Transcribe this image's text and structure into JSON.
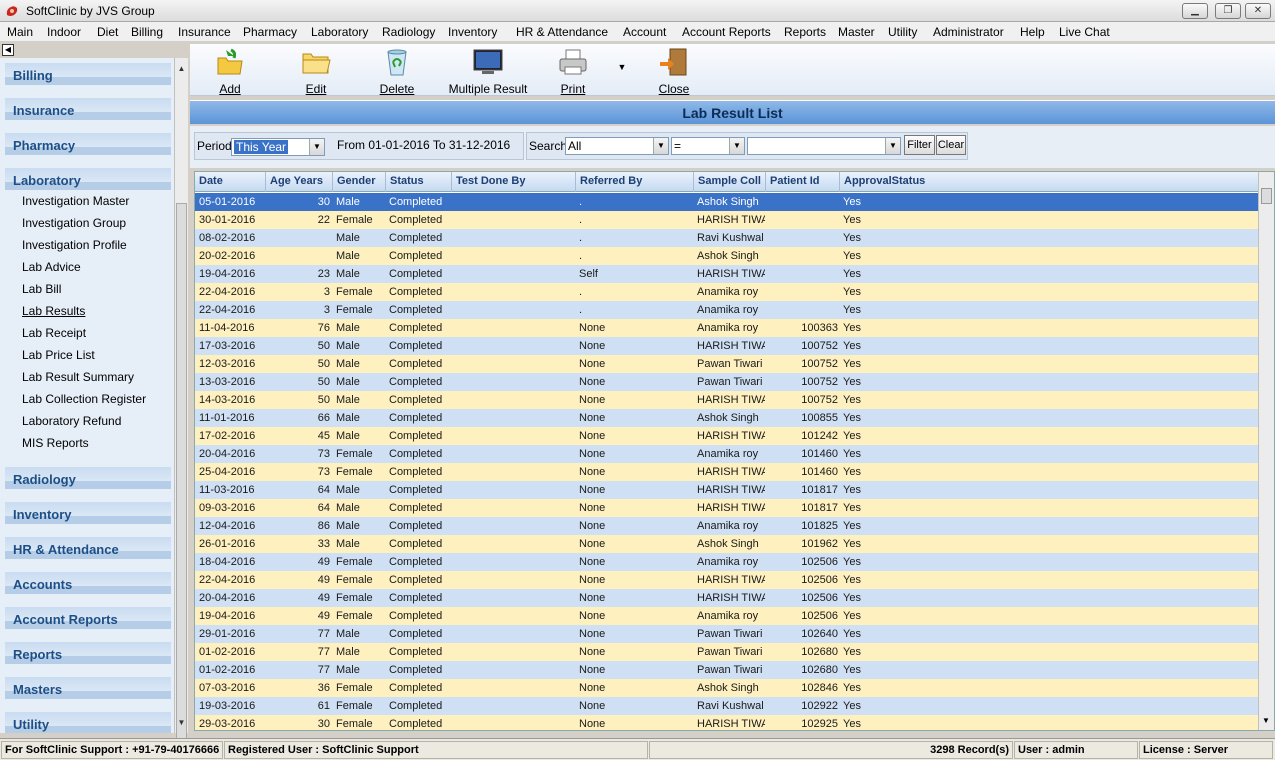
{
  "window": {
    "title": "SoftClinic by JVS Group"
  },
  "menu": [
    "Main",
    "Indoor",
    "Diet",
    "Billing",
    "Insurance",
    "Pharmacy",
    "Laboratory",
    "Radiology",
    "Inventory",
    "HR & Attendance",
    "Account",
    "Account Reports",
    "Reports",
    "Master",
    "Utility",
    "Administrator",
    "Help",
    "Live Chat"
  ],
  "sidebar": {
    "categories_top": [
      "Billing",
      "Insurance",
      "Pharmacy",
      "Laboratory"
    ],
    "laboratory_items": [
      "Investigation Master",
      "Investigation Group",
      "Investigation Profile",
      "Lab Advice",
      "Lab Bill",
      "Lab Results",
      "Lab Receipt",
      "Lab Price List",
      "Lab Result Summary",
      "Lab Collection Register",
      "Laboratory Refund",
      "MIS Reports"
    ],
    "active_item": "Lab Results",
    "categories_bottom": [
      "Radiology",
      "Inventory",
      "HR & Attendance",
      "Accounts",
      "Account Reports",
      "Reports",
      "Masters",
      "Utility"
    ]
  },
  "toolbar": {
    "add": "Add",
    "edit": "Edit",
    "delete": "Delete",
    "multiple_result": "Multiple Result",
    "print": "Print",
    "close": "Close"
  },
  "list_title": "Lab Result List",
  "filter": {
    "period_label": "Period",
    "period_value": "This Year",
    "date_range": "From  01-01-2016 To 31-12-2016",
    "search_label": "Search",
    "search_field": "All",
    "operator": "=",
    "search_value": "",
    "filter_btn": "Filter",
    "clear_btn": "Clear"
  },
  "grid": {
    "columns": [
      "Date",
      "Age Years",
      "Gender",
      "Status",
      "Test Done By",
      "Referred By",
      "Sample Coll",
      "Patient Id",
      "ApprovalStatus"
    ],
    "rows": [
      [
        "05-01-2016",
        "30",
        "Male",
        "Completed",
        "",
        ".",
        "Ashok Singh",
        "",
        "Yes"
      ],
      [
        "30-01-2016",
        "22",
        "Female",
        "Completed",
        "",
        ".",
        "HARISH TIWA",
        "",
        "Yes"
      ],
      [
        "08-02-2016",
        "",
        "Male",
        "Completed",
        "",
        ".",
        "Ravi Kushwal",
        "",
        "Yes"
      ],
      [
        "20-02-2016",
        "",
        "Male",
        "Completed",
        "",
        ".",
        "Ashok Singh",
        "",
        "Yes"
      ],
      [
        "19-04-2016",
        "23",
        "Male",
        "Completed",
        "",
        "Self",
        "HARISH TIWA",
        "",
        "Yes"
      ],
      [
        "22-04-2016",
        "3",
        "Female",
        "Completed",
        "",
        ".",
        "Anamika roy",
        "",
        "Yes"
      ],
      [
        "22-04-2016",
        "3",
        "Female",
        "Completed",
        "",
        ".",
        "Anamika roy",
        "",
        "Yes"
      ],
      [
        "11-04-2016",
        "76",
        "Male",
        "Completed",
        "",
        "None",
        "Anamika roy",
        "100363",
        "Yes"
      ],
      [
        "17-03-2016",
        "50",
        "Male",
        "Completed",
        "",
        " None",
        "HARISH TIWA",
        "100752",
        "Yes"
      ],
      [
        "12-03-2016",
        "50",
        "Male",
        "Completed",
        "",
        " None",
        "Pawan Tiwari",
        "100752",
        "Yes"
      ],
      [
        "13-03-2016",
        "50",
        "Male",
        "Completed",
        "",
        " None",
        "Pawan Tiwari",
        "100752",
        "Yes"
      ],
      [
        "14-03-2016",
        "50",
        "Male",
        "Completed",
        "",
        " None",
        "HARISH TIWA",
        "100752",
        "Yes"
      ],
      [
        "11-01-2016",
        "66",
        "Male",
        "Completed",
        "",
        "None",
        "Ashok Singh",
        "100855",
        "Yes"
      ],
      [
        "17-02-2016",
        "45",
        "Male",
        "Completed",
        "",
        " None",
        "HARISH TIWA",
        "101242",
        "Yes"
      ],
      [
        "20-04-2016",
        "73",
        "Female",
        "Completed",
        "",
        " None",
        "Anamika roy",
        "101460",
        "Yes"
      ],
      [
        "25-04-2016",
        "73",
        "Female",
        "Completed",
        "",
        " None",
        "HARISH TIWA",
        "101460",
        "Yes"
      ],
      [
        "11-03-2016",
        "64",
        "Male",
        "Completed",
        "",
        " None",
        "HARISH TIWA",
        "101817",
        "Yes"
      ],
      [
        "09-03-2016",
        "64",
        "Male",
        "Completed",
        "",
        " None",
        "HARISH TIWA",
        "101817",
        "Yes"
      ],
      [
        "12-04-2016",
        "86",
        "Male",
        "Completed",
        "",
        " None",
        "Anamika roy",
        "101825",
        "Yes"
      ],
      [
        "26-01-2016",
        "33",
        "Male",
        "Completed",
        "",
        " None",
        "Ashok Singh",
        "101962",
        "Yes"
      ],
      [
        "18-04-2016",
        "49",
        "Female",
        "Completed",
        "",
        " None",
        "Anamika roy",
        "102506",
        "Yes"
      ],
      [
        "22-04-2016",
        "49",
        "Female",
        "Completed",
        "",
        "None",
        "HARISH TIWA",
        "102506",
        "Yes"
      ],
      [
        "20-04-2016",
        "49",
        "Female",
        "Completed",
        "",
        " None",
        "HARISH TIWA",
        "102506",
        "Yes"
      ],
      [
        "19-04-2016",
        "49",
        "Female",
        "Completed",
        "",
        " None",
        "Anamika roy",
        "102506",
        "Yes"
      ],
      [
        "29-01-2016",
        "77",
        "Male",
        "Completed",
        "",
        " None",
        "Pawan Tiwari",
        "102640",
        "Yes"
      ],
      [
        "01-02-2016",
        "77",
        "Male",
        "Completed",
        "",
        " None",
        "Pawan Tiwari",
        "102680",
        "Yes"
      ],
      [
        "01-02-2016",
        "77",
        "Male",
        "Completed",
        "",
        " None",
        "Pawan Tiwari",
        "102680",
        "Yes"
      ],
      [
        "07-03-2016",
        "36",
        "Female",
        "Completed",
        "",
        " None",
        "Ashok Singh",
        "102846",
        "Yes"
      ],
      [
        "19-03-2016",
        "61",
        "Female",
        "Completed",
        "",
        " None",
        "Ravi Kushwal",
        "102922",
        "Yes"
      ],
      [
        "29-03-2016",
        "30",
        "Female",
        "Completed",
        "",
        " None",
        "HARISH TIWA",
        "102925",
        "Yes"
      ]
    ]
  },
  "status": {
    "support": "For SoftClinic Support : +91-79-40176666",
    "registered": "Registered User : SoftClinic Support",
    "records": "3298 Record(s)",
    "user": "User : admin",
    "license": "License : Server"
  },
  "colors": {
    "selected_row": "#3a72c8",
    "odd_row": "#fff0bf",
    "even_row": "#cfe0f4",
    "accent": "#1d4f86"
  }
}
